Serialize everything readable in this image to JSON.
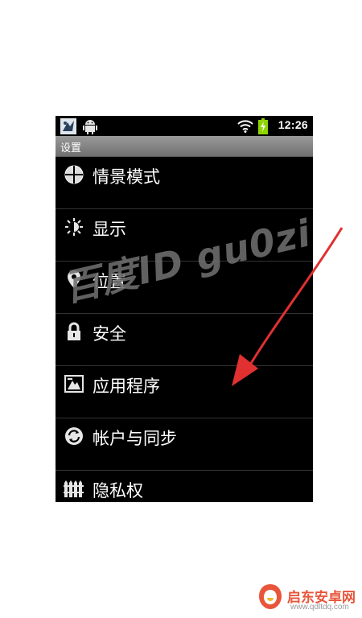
{
  "status_bar": {
    "time": "12:26",
    "icons": [
      "app-notification-icon",
      "android-icon",
      "wifi-icon",
      "battery-charging-icon"
    ]
  },
  "title_bar": {
    "title": "设置"
  },
  "settings_items": [
    {
      "label": "情景模式",
      "icon": "sound-profile-icon"
    },
    {
      "label": "显示",
      "icon": "display-brightness-icon"
    },
    {
      "label": "位置",
      "icon": "location-pin-icon"
    },
    {
      "label": "安全",
      "icon": "lock-icon"
    },
    {
      "label": "应用程序",
      "icon": "applications-icon"
    },
    {
      "label": "帐户与同步",
      "icon": "sync-icon"
    },
    {
      "label": "隐私权",
      "icon": "privacy-fence-icon"
    }
  ],
  "overlay": {
    "watermark": "百度ID gu0zi",
    "arrow_color": "#e03030"
  },
  "footer_brand": {
    "name": "启东安卓网",
    "url": "www.qdltdq.com",
    "color": "#e8553a"
  }
}
